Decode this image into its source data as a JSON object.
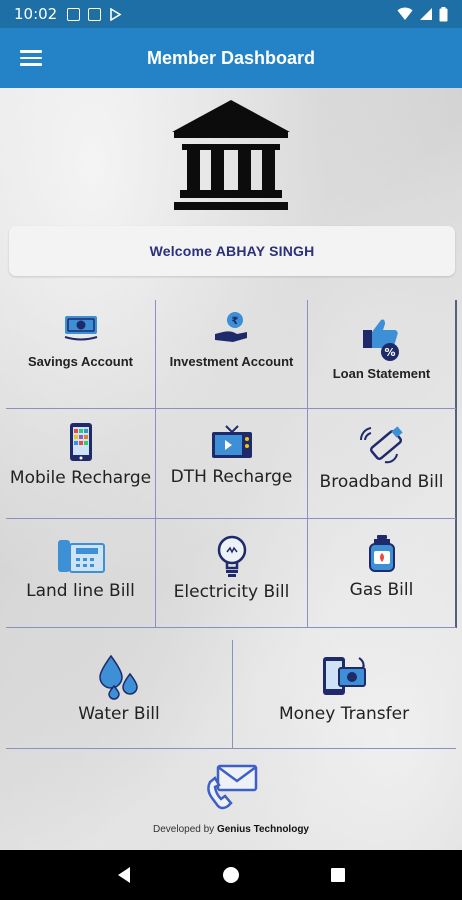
{
  "status_bar": {
    "time": "10:02"
  },
  "app_bar": {
    "title": "Member Dashboard"
  },
  "welcome": {
    "text": "Welcome ABHAY SINGH"
  },
  "tiles": [
    {
      "label": "Savings Account",
      "icon": "savings-icon"
    },
    {
      "label": "Investment Account",
      "icon": "investment-icon"
    },
    {
      "label": "Loan Statement",
      "icon": "loan-icon"
    },
    {
      "label": "Mobile Recharge",
      "icon": "mobile-icon"
    },
    {
      "label": "DTH Recharge",
      "icon": "dth-icon"
    },
    {
      "label": "Broadband Bill",
      "icon": "broadband-icon"
    },
    {
      "label": "Land line Bill",
      "icon": "landline-icon"
    },
    {
      "label": "Electricity Bill",
      "icon": "bulb-icon"
    },
    {
      "label": "Gas Bill",
      "icon": "gas-icon"
    },
    {
      "label": "Water Bill",
      "icon": "water-icon"
    },
    {
      "label": "Money Transfer",
      "icon": "money-transfer-icon"
    }
  ],
  "footer": {
    "developed_by_prefix": "Developed by",
    "developer": "Genius Technology"
  },
  "colors": {
    "status_bar": "#1d6fa5",
    "app_bar": "#2383c6",
    "accent_navy": "#2c2f7a",
    "icon_blue": "#3d8fd6"
  }
}
